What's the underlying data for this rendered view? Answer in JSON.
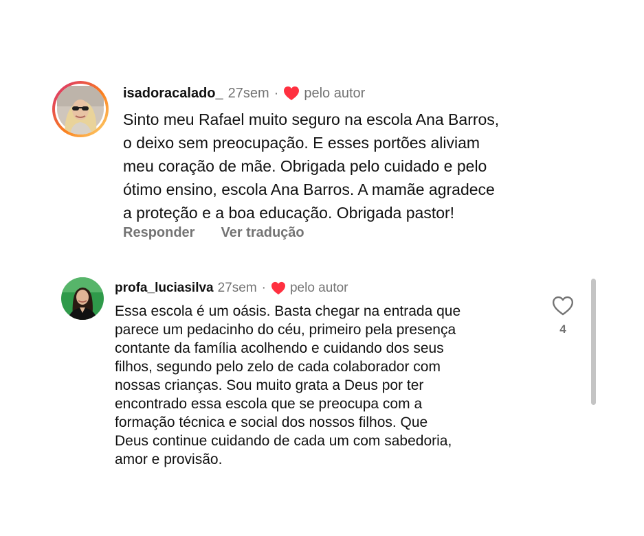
{
  "comments": [
    {
      "username": "isadoracalado_",
      "time": "27sem",
      "separator": "·",
      "author_like_label": "pelo autor",
      "avatar_icon": "profile-photo-woman-sunglasses",
      "has_story_ring": true,
      "lines": [
        "Sinto meu Rafael muito seguro na escola Ana Barros,",
        "o deixo sem preocupação. E esses portões aliviam",
        "meu coração de mãe. Obrigada pelo cuidado e pelo",
        "ótimo ensino, escola Ana Barros. A mamãe agradece",
        "a proteção e a boa educação. Obrigada pastor!"
      ],
      "reply_label": "Responder",
      "translate_label": "Ver tradução"
    },
    {
      "username": "profa_luciasilva",
      "time": "27sem",
      "separator": "·",
      "author_like_label": "pelo autor",
      "avatar_icon": "profile-photo-woman-green-background",
      "has_story_ring": false,
      "lines": [
        "Essa escola é um oásis. Basta chegar na entrada que",
        "parece um pedacinho do céu, primeiro pela presença",
        "contante da família acolhendo e cuidando dos seus",
        "filhos, segundo pelo zelo de cada colaborador com",
        "nossas crianças. Sou muito grata a Deus por ter",
        "encontrado essa escola que se preocupa com a",
        "formação técnica e social dos nossos filhos. Que",
        "Deus continue cuidando de cada um com sabedoria,",
        "amor e provisão."
      ],
      "like_icon": "heart-outline-icon",
      "like_count": "4"
    }
  ],
  "colors": {
    "text": "#111111",
    "meta": "#737373",
    "heart_red": "#ff3040",
    "scrollbar": "#c4c4c4",
    "story_ring_start": "#d62976",
    "story_ring_end": "#feda75"
  }
}
